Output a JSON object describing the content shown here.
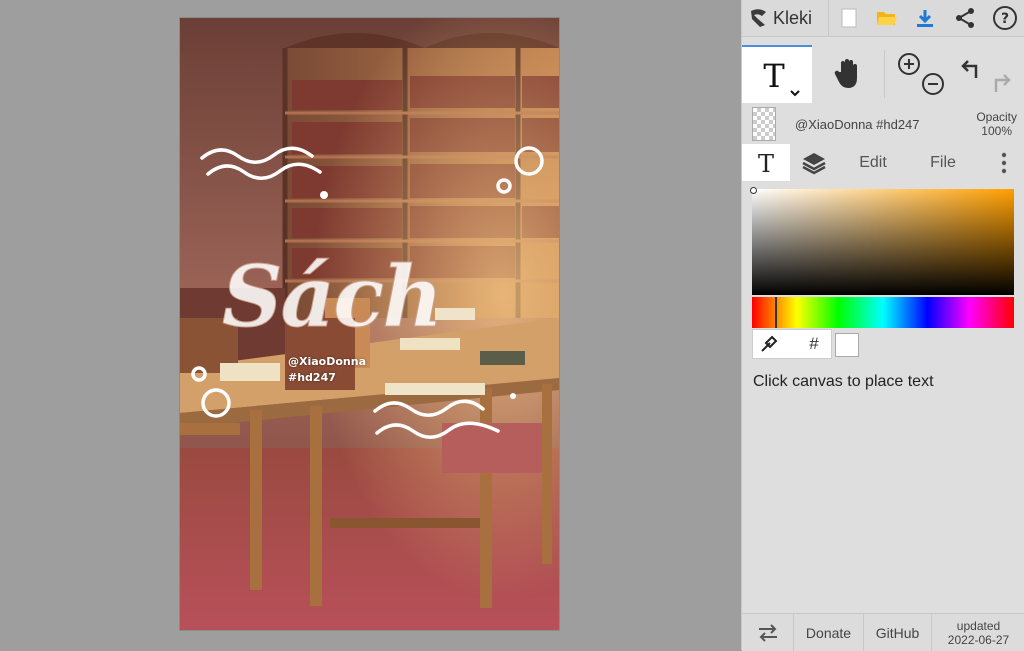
{
  "app": {
    "name": "Kleki"
  },
  "canvas": {
    "watermark_line1": "@XiaoDonna",
    "watermark_line2": "#hd247"
  },
  "topbar": {
    "icons": [
      "new-file-icon",
      "open-folder-icon",
      "download-icon",
      "share-icon",
      "help-icon"
    ]
  },
  "tools": {
    "active": "text",
    "items": [
      "text-tool-icon",
      "hand-tool-icon",
      "zoom-icon",
      "undo-icon",
      "redo-icon"
    ]
  },
  "layer": {
    "name": "@XiaoDonna #hd247",
    "opacity_label": "Opacity",
    "opacity_value": "100%"
  },
  "tabs": {
    "edit": "Edit",
    "file": "File"
  },
  "color": {
    "primary": "#ffffff",
    "hash_label": "#"
  },
  "hint": "Click canvas to place text",
  "footer": {
    "donate": "Donate",
    "github": "GitHub",
    "updated_label": "updated",
    "updated_date": "2022-06-27"
  },
  "colors": {
    "accent": "#4a90d9",
    "download": "#1e7ad3",
    "folder": "#f2b416"
  }
}
